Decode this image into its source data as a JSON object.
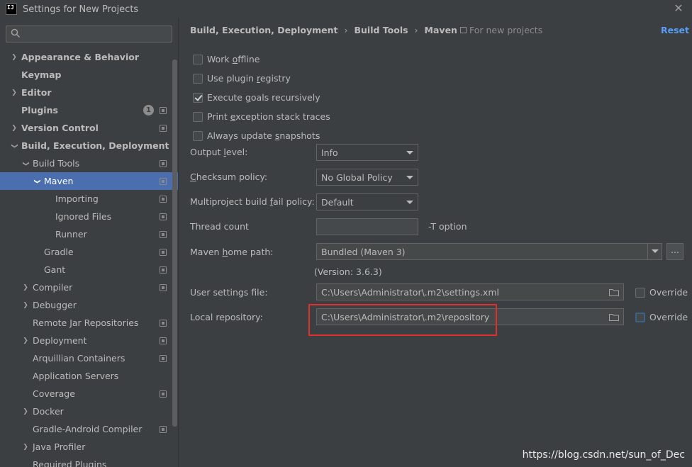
{
  "window": {
    "title": "Settings for New Projects",
    "logo_text": "IJ"
  },
  "sidebar": {
    "search_placeholder": "",
    "items": [
      {
        "label": "Appearance & Behavior",
        "level": 0,
        "chevron": "right",
        "bold": true,
        "proj": false
      },
      {
        "label": "Keymap",
        "level": 0,
        "chevron": "none",
        "bold": true,
        "proj": false
      },
      {
        "label": "Editor",
        "level": 0,
        "chevron": "right",
        "bold": true,
        "proj": false
      },
      {
        "label": "Plugins",
        "level": 0,
        "chevron": "none",
        "bold": true,
        "proj": true,
        "badge": "1"
      },
      {
        "label": "Version Control",
        "level": 0,
        "chevron": "right",
        "bold": true,
        "proj": true
      },
      {
        "label": "Build, Execution, Deployment",
        "level": 0,
        "chevron": "down",
        "bold": true,
        "proj": false
      },
      {
        "label": "Build Tools",
        "level": 1,
        "chevron": "down",
        "bold": false,
        "proj": true
      },
      {
        "label": "Maven",
        "level": 2,
        "chevron": "down",
        "bold": false,
        "proj": true,
        "selected": true
      },
      {
        "label": "Importing",
        "level": 3,
        "chevron": "none",
        "bold": false,
        "proj": true
      },
      {
        "label": "Ignored Files",
        "level": 3,
        "chevron": "none",
        "bold": false,
        "proj": true
      },
      {
        "label": "Runner",
        "level": 3,
        "chevron": "none",
        "bold": false,
        "proj": true
      },
      {
        "label": "Gradle",
        "level": 2,
        "chevron": "none",
        "bold": false,
        "proj": true
      },
      {
        "label": "Gant",
        "level": 2,
        "chevron": "none",
        "bold": false,
        "proj": true
      },
      {
        "label": "Compiler",
        "level": 1,
        "chevron": "right",
        "bold": false,
        "proj": true
      },
      {
        "label": "Debugger",
        "level": 1,
        "chevron": "right",
        "bold": false,
        "proj": false
      },
      {
        "label": "Remote Jar Repositories",
        "level": 1,
        "chevron": "none",
        "bold": false,
        "proj": true
      },
      {
        "label": "Deployment",
        "level": 1,
        "chevron": "right",
        "bold": false,
        "proj": true
      },
      {
        "label": "Arquillian Containers",
        "level": 1,
        "chevron": "none",
        "bold": false,
        "proj": true
      },
      {
        "label": "Application Servers",
        "level": 1,
        "chevron": "none",
        "bold": false,
        "proj": false
      },
      {
        "label": "Coverage",
        "level": 1,
        "chevron": "none",
        "bold": false,
        "proj": true
      },
      {
        "label": "Docker",
        "level": 1,
        "chevron": "right",
        "bold": false,
        "proj": false
      },
      {
        "label": "Gradle-Android Compiler",
        "level": 1,
        "chevron": "none",
        "bold": false,
        "proj": true
      },
      {
        "label": "Java Profiler",
        "level": 1,
        "chevron": "right",
        "bold": false,
        "proj": false
      },
      {
        "label": "Required Plugins",
        "level": 1,
        "chevron": "none",
        "bold": false,
        "proj": false
      }
    ]
  },
  "breadcrumb": {
    "parts": [
      "Build, Execution, Deployment",
      "Build Tools",
      "Maven"
    ],
    "separator": "›",
    "scope": "For new projects",
    "reset": "Reset"
  },
  "checkboxes": [
    {
      "pre": "Work ",
      "key": "o",
      "post": "ffline",
      "checked": false
    },
    {
      "pre": "Use plugin ",
      "key": "r",
      "post": "egistry",
      "checked": false
    },
    {
      "pre": "Execute ",
      "key": "g",
      "post": "oals recursively",
      "checked": true
    },
    {
      "pre": "Print ",
      "key": "e",
      "post": "xception stack traces",
      "checked": false
    },
    {
      "pre": "Always update ",
      "key": "s",
      "post": "napshots",
      "checked": false
    }
  ],
  "fields": {
    "output_level": {
      "pre": "Output ",
      "key": "l",
      "post": "evel:",
      "value": "Info"
    },
    "checksum_policy": {
      "pre": "",
      "key": "C",
      "post": "hecksum policy:",
      "value": "No Global Policy"
    },
    "multiproject": {
      "pre": "Multiproject build ",
      "key": "f",
      "post": "ail policy:",
      "value": "Default"
    },
    "thread_count": {
      "label": "Thread count",
      "value": "",
      "suffix": "-T option"
    },
    "maven_home": {
      "pre": "Maven ",
      "key": "h",
      "post": "ome path:",
      "value": "Bundled (Maven 3)",
      "browse": "...",
      "version": "(Version: 3.6.3)"
    },
    "user_settings": {
      "label": "User settings file:",
      "value": "C:\\Users\\Administrator\\.m2\\settings.xml",
      "override": "Override",
      "override_checked": false
    },
    "local_repo": {
      "label": "Local repository:",
      "value": "C:\\Users\\Administrator\\.m2\\repository",
      "override": "Override",
      "override_checked": false
    }
  },
  "watermark": "https://blog.csdn.net/sun_of_Dec",
  "colors": {
    "selection": "#4b6eaf",
    "link": "#589df6",
    "highlight": "#e0302d"
  }
}
